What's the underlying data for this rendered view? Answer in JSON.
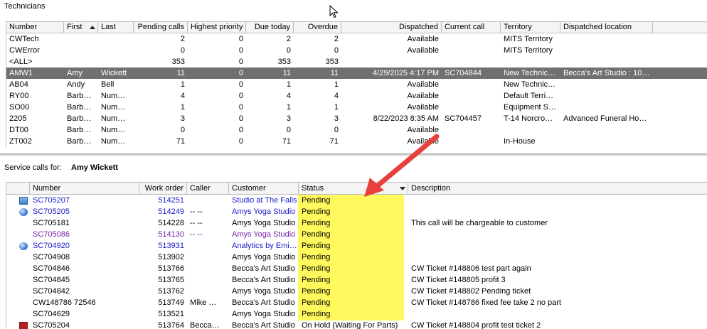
{
  "technicians_panel": {
    "title": "Technicians",
    "columns": [
      "Number",
      "First",
      "Last",
      "Pending calls",
      "Highest priority",
      "Due today",
      "Overdue",
      "Dispatched",
      "Current call",
      "Territory",
      "Dispatched location"
    ],
    "rows": [
      {
        "number": "CWTech",
        "first": "",
        "last": "",
        "pending": "2",
        "priority": "0",
        "due": "2",
        "overdue": "2",
        "dispatched": "Available",
        "call": "",
        "territory": "MITS Territory",
        "location": ""
      },
      {
        "number": "CWError",
        "first": "",
        "last": "",
        "pending": "0",
        "priority": "0",
        "due": "0",
        "overdue": "0",
        "dispatched": "Available",
        "call": "",
        "territory": "MITS Territory",
        "location": ""
      },
      {
        "number": "<ALL>",
        "first": "",
        "last": "",
        "pending": "353",
        "priority": "0",
        "due": "353",
        "overdue": "353",
        "dispatched": "",
        "call": "",
        "territory": "",
        "location": ""
      },
      {
        "number": "AMW1",
        "first": "Amy",
        "last": "Wickett",
        "pending": "11",
        "priority": "0",
        "due": "11",
        "overdue": "11",
        "dispatched": "4/29/2025 4:17 PM",
        "call": "SC704844",
        "territory": "New Technic…",
        "location": "Becca's Art Studio : 10…"
      },
      {
        "number": "AB04",
        "first": "Andy",
        "last": "Bell",
        "pending": "1",
        "priority": "0",
        "due": "1",
        "overdue": "1",
        "dispatched": "Available",
        "call": "",
        "territory": "New Technic…",
        "location": ""
      },
      {
        "number": "RY00",
        "first": "Barb…",
        "last": "Num…",
        "pending": "4",
        "priority": "0",
        "due": "4",
        "overdue": "4",
        "dispatched": "Available",
        "call": "",
        "territory": "Default Terri…",
        "location": ""
      },
      {
        "number": "SO00",
        "first": "Barb…",
        "last": "Num…",
        "pending": "1",
        "priority": "0",
        "due": "1",
        "overdue": "1",
        "dispatched": "Available",
        "call": "",
        "territory": "Equipment S…",
        "location": ""
      },
      {
        "number": "2205",
        "first": "Barb…",
        "last": "Num…",
        "pending": "3",
        "priority": "0",
        "due": "3",
        "overdue": "3",
        "dispatched": "8/22/2023 8:35 AM",
        "call": "SC704457",
        "territory": "T-14 Norcro…",
        "location": "Advanced Funeral Ho…"
      },
      {
        "number": "DT00",
        "first": "Barb…",
        "last": "Num…",
        "pending": "0",
        "priority": "0",
        "due": "0",
        "overdue": "0",
        "dispatched": "Available",
        "call": "",
        "territory": "",
        "location": ""
      },
      {
        "number": "ZT002",
        "first": "Barb…",
        "last": "Num…",
        "pending": "71",
        "priority": "0",
        "due": "71",
        "overdue": "71",
        "dispatched": "Available",
        "call": "",
        "territory": "In-House",
        "location": ""
      }
    ],
    "selected_index": 3
  },
  "service_calls": {
    "label": "Service calls for:",
    "technician_name": "Amy Wickett",
    "columns": [
      "Number",
      "Work order",
      "Caller",
      "Customer",
      "Status",
      "Description"
    ],
    "rows": [
      {
        "icon": "ticket-icon",
        "number": "SC705207",
        "wo": "514251",
        "caller": "",
        "customer": "Studio at The Falls",
        "status": "Pending",
        "description": "",
        "color": "blue"
      },
      {
        "icon": "sphere-icon",
        "number": "SC705205",
        "wo": "514249",
        "caller": "-- --",
        "customer": "Amys Yoga Studio",
        "status": "Pending",
        "description": "",
        "color": "blue"
      },
      {
        "icon": "",
        "number": "SC705181",
        "wo": "514228",
        "caller": "-- --",
        "customer": "Amys Yoga Studio",
        "status": "Pending",
        "description": "This call will be chargeable to customer",
        "color": "black"
      },
      {
        "icon": "",
        "number": "SC705086",
        "wo": "514130",
        "caller": "-- --",
        "customer": "Amys Yoga Studio",
        "status": "Pending",
        "description": "",
        "color": "purple"
      },
      {
        "icon": "sphere-icon",
        "number": "SC704920",
        "wo": "513931",
        "caller": "",
        "customer": "Analytics by Emi…",
        "status": "Pending",
        "description": "",
        "color": "blue"
      },
      {
        "icon": "",
        "number": "SC704908",
        "wo": "513902",
        "caller": "",
        "customer": "Amys Yoga Studio",
        "status": "Pending",
        "description": "",
        "color": "black"
      },
      {
        "icon": "",
        "number": "SC704846",
        "wo": "513766",
        "caller": "",
        "customer": "Becca's Art Studio",
        "status": "Pending",
        "description": "CW Ticket #148806 test part again",
        "color": "black"
      },
      {
        "icon": "",
        "number": "SC704845",
        "wo": "513765",
        "caller": "",
        "customer": "Becca's Art Studio",
        "status": "Pending",
        "description": "CW Ticket #148805 profit 3",
        "color": "black"
      },
      {
        "icon": "",
        "number": "SC704842",
        "wo": "513762",
        "caller": "",
        "customer": "Amys Yoga Studio",
        "status": "Pending",
        "description": "CW Ticket #148802 Pending ticket",
        "color": "black"
      },
      {
        "icon": "",
        "number": "CW148786 72546",
        "wo": "513749",
        "caller": "Mike …",
        "customer": "Becca's Art Studio",
        "status": "Pending",
        "description": "CW Ticket #148786 fixed fee take 2 no part",
        "color": "black"
      },
      {
        "icon": "",
        "number": "SC704629",
        "wo": "513521",
        "caller": "",
        "customer": "Amys Yoga Studio",
        "status": "Pending",
        "description": "",
        "color": "black"
      },
      {
        "icon": "book-icon",
        "number": "SC705204",
        "wo": "513764",
        "caller": "Becca…",
        "customer": "Becca's Art Studio",
        "status": "On Hold (Waiting For Parts)",
        "description": "CW Ticket #148804 profit test ticket 2",
        "color": "black"
      }
    ]
  },
  "colors": {
    "selected_row": "#707070",
    "highlight": "#fff61e",
    "arrow": "#e8413c",
    "link_blue": "#1a1ac8",
    "link_purple": "#7a22a8"
  }
}
